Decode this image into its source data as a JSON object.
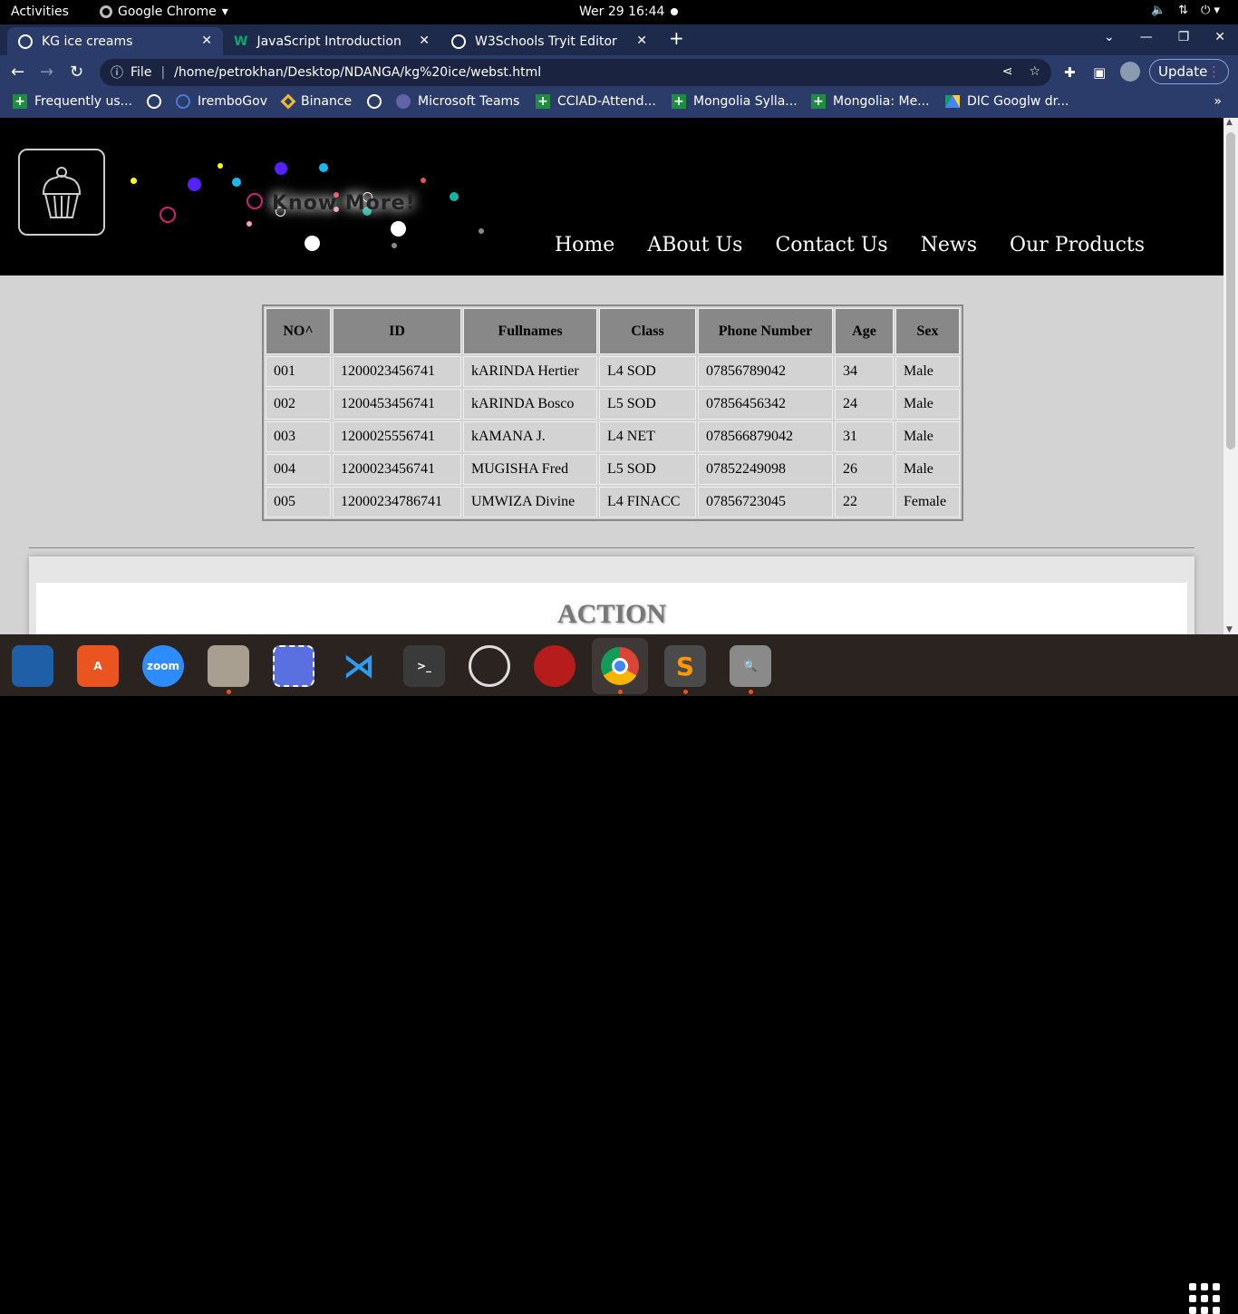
{
  "topbar": {
    "activities": "Activities",
    "app": "Google Chrome",
    "clock": "Wer 29  16:44"
  },
  "tabs": [
    {
      "label": "KG ice creams"
    },
    {
      "label": "JavaScript Introduction"
    },
    {
      "label": "W3Schools Tryit Editor"
    }
  ],
  "address": {
    "scheme": "File",
    "url": "/home/petrokhan/Desktop/NDANGA/kg%20ice/webst.html"
  },
  "update_label": "Update",
  "bookmarks": [
    {
      "label": "Frequently us...",
      "icon": "sheets-icon"
    },
    {
      "label": "IremboGov",
      "icon": "irembo-icon"
    },
    {
      "label": "Binance",
      "icon": "binance-icon"
    },
    {
      "label": "Microsoft Teams",
      "icon": "teams-icon"
    },
    {
      "label": "CCIAD-Attend...",
      "icon": "sheets-icon"
    },
    {
      "label": "Mongolia Sylla...",
      "icon": "sheets-icon"
    },
    {
      "label": "Mongolia: Me...",
      "icon": "sheets-icon"
    },
    {
      "label": "DIC Googlw dr...",
      "icon": "drive-icon"
    }
  ],
  "site": {
    "knowmore": "Know More!",
    "menu": [
      "Home",
      "ABout Us",
      "Contact Us",
      "News",
      "Our Products"
    ]
  },
  "table": {
    "headers": [
      "NO^",
      "ID",
      "Fullnames",
      "Class",
      "Phone Number",
      "Age",
      "Sex"
    ],
    "rows": [
      [
        "001",
        "1200023456741",
        "kARINDA Hertier",
        "L4 SOD",
        "07856789042",
        "34",
        "Male"
      ],
      [
        "002",
        "1200453456741",
        "kARINDA Bosco",
        "L5 SOD",
        "07856456342",
        "24",
        "Male"
      ],
      [
        "003",
        "1200025556741",
        "kAMANA J.",
        "L4 NET",
        "078566879042",
        "31",
        "Male"
      ],
      [
        "004",
        "1200023456741",
        "MUGISHA Fred",
        "L5 SOD",
        "07852249098",
        "26",
        "Male"
      ],
      [
        "005",
        "12000234786741",
        "UMWIZA Divine",
        "L4 FINACC",
        "07856723045",
        "22",
        "Female"
      ]
    ]
  },
  "action_title": "ACTION",
  "dock": [
    {
      "name": "libreoffice-writer-icon",
      "color": "#1f5fa8",
      "label": ""
    },
    {
      "name": "app-center-icon",
      "color": "#e95420",
      "label": ""
    },
    {
      "name": "zoom-icon",
      "color": "#2d8cff",
      "label": "zoom"
    },
    {
      "name": "files-icon",
      "color": "#a89f91",
      "label": ""
    },
    {
      "name": "screenshot-icon",
      "color": "#5a6fe0",
      "label": ""
    },
    {
      "name": "vscode-icon",
      "color": "#2a2320",
      "label": ""
    },
    {
      "name": "terminal-icon",
      "color": "#3a3a3a",
      "label": ">_"
    },
    {
      "name": "software-updater-icon",
      "color": "#555",
      "label": ""
    },
    {
      "name": "screen-recorder-icon",
      "color": "#b71c1c",
      "label": ""
    },
    {
      "name": "chrome-icon",
      "color": "#444",
      "label": ""
    },
    {
      "name": "sublime-icon",
      "color": "#4a4a4a",
      "label": ""
    },
    {
      "name": "search-image-icon",
      "color": "#8a8a8a",
      "label": ""
    }
  ]
}
